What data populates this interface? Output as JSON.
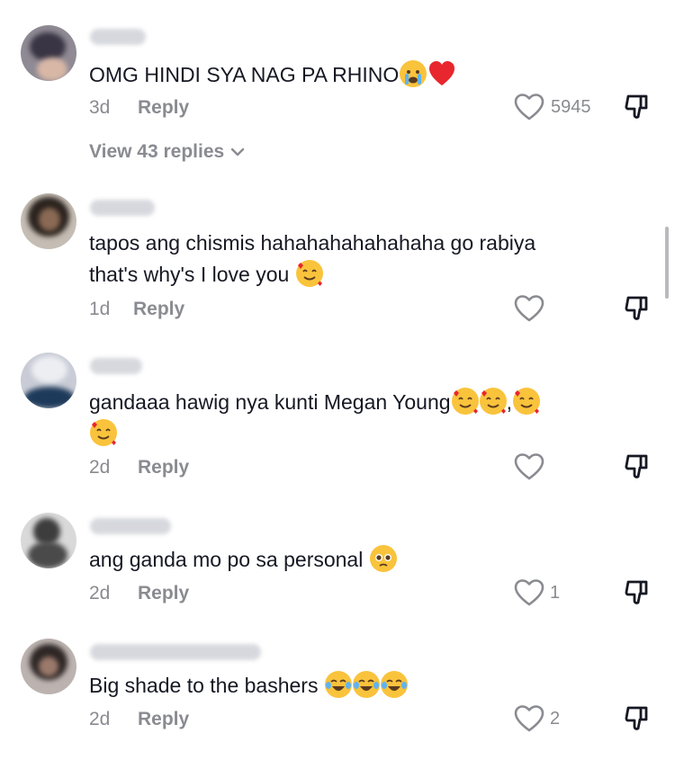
{
  "comments": [
    {
      "text": "OMG HINDI SYA NAG PA RHINO",
      "emojis": [
        "crying-emoji",
        "heart-emoji"
      ],
      "time": "3d",
      "reply_label": "Reply",
      "likes": "5945",
      "view_replies": "View 43 replies"
    },
    {
      "text_line1": "tapos ang chismis hahahahahahahaha go rabiya",
      "text_line2": "that's why's I love you",
      "emojis": [
        "smiling-face-with-hearts-emoji"
      ],
      "time": "1d",
      "reply_label": "Reply",
      "likes": ""
    },
    {
      "text_line1": "gandaaa hawig nya kunti Megan Young",
      "text_separator": ",",
      "emojis": [
        "smiling-face-with-hearts-emoji",
        "smiling-face-with-hearts-emoji",
        "smiling-face-with-hearts-emoji",
        "smiling-face-with-hearts-emoji"
      ],
      "time": "2d",
      "reply_label": "Reply",
      "likes": ""
    },
    {
      "text": "ang ganda mo po sa personal",
      "emojis": [
        "pleading-face-emoji"
      ],
      "time": "2d",
      "reply_label": "Reply",
      "likes": "1"
    },
    {
      "text": "Big shade to the bashers",
      "emojis": [
        "face-with-tears-of-joy-emoji",
        "face-with-tears-of-joy-emoji",
        "face-with-tears-of-joy-emoji"
      ],
      "time": "2d",
      "reply_label": "Reply",
      "likes": "2"
    }
  ],
  "colors": {
    "text": "#161823",
    "secondary": "#8a8b91",
    "heart_red": "#e8262d",
    "emoji_yellow": "#f9c33c"
  }
}
